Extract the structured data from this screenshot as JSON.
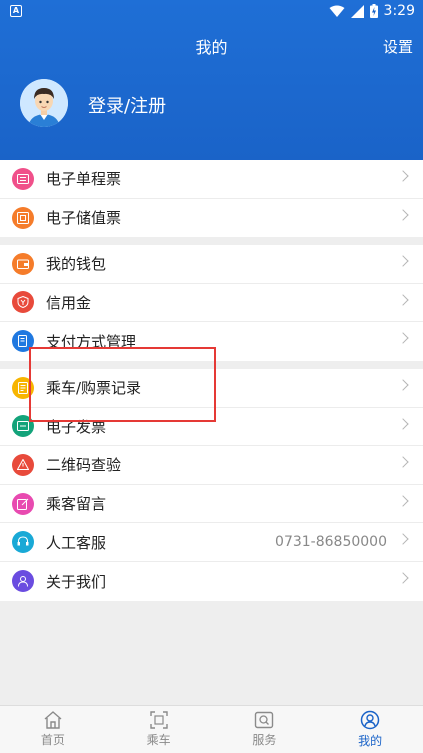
{
  "status_bar": {
    "time": "3:29",
    "left_badge": "A"
  },
  "header": {
    "title": "我的",
    "settings_label": "设置",
    "login_text": "登录/注册"
  },
  "groups": [
    [
      {
        "label": "电子单程票",
        "icon": "single-ticket-icon",
        "color": "#f0508a"
      },
      {
        "label": "电子储值票",
        "icon": "stored-value-ticket-icon",
        "color": "#f57c2a"
      }
    ],
    [
      {
        "label": "我的钱包",
        "icon": "wallet-icon",
        "color": "#f57c2a"
      },
      {
        "label": "信用金",
        "icon": "credit-icon",
        "color": "#e84a3b"
      },
      {
        "label": "支付方式管理",
        "icon": "payment-method-icon",
        "color": "#1f78e0"
      }
    ],
    [
      {
        "label": "乘车/购票记录",
        "icon": "ride-record-icon",
        "color": "#f7b500"
      },
      {
        "label": "电子发票",
        "icon": "invoice-icon",
        "color": "#13a37a"
      },
      {
        "label": "二维码查验",
        "icon": "qr-verify-icon",
        "color": "#e84a3b"
      },
      {
        "label": "乘客留言",
        "icon": "message-icon",
        "color": "#e84ab0"
      },
      {
        "label": "人工客服",
        "icon": "customer-service-icon",
        "color": "#19a9d6",
        "value": "0731-86850000"
      },
      {
        "label": "关于我们",
        "icon": "about-icon",
        "color": "#6a4ce0"
      }
    ]
  ],
  "tabs": [
    {
      "label": "首页",
      "icon": "home-icon",
      "active": false
    },
    {
      "label": "乘车",
      "icon": "ride-qr-icon",
      "active": false
    },
    {
      "label": "服务",
      "icon": "service-icon",
      "active": false
    },
    {
      "label": "我的",
      "icon": "profile-icon",
      "active": true
    }
  ],
  "colors": {
    "header_blue": "#1a63c8",
    "active_tab": "#1a63c8",
    "highlight": "#e53935"
  }
}
